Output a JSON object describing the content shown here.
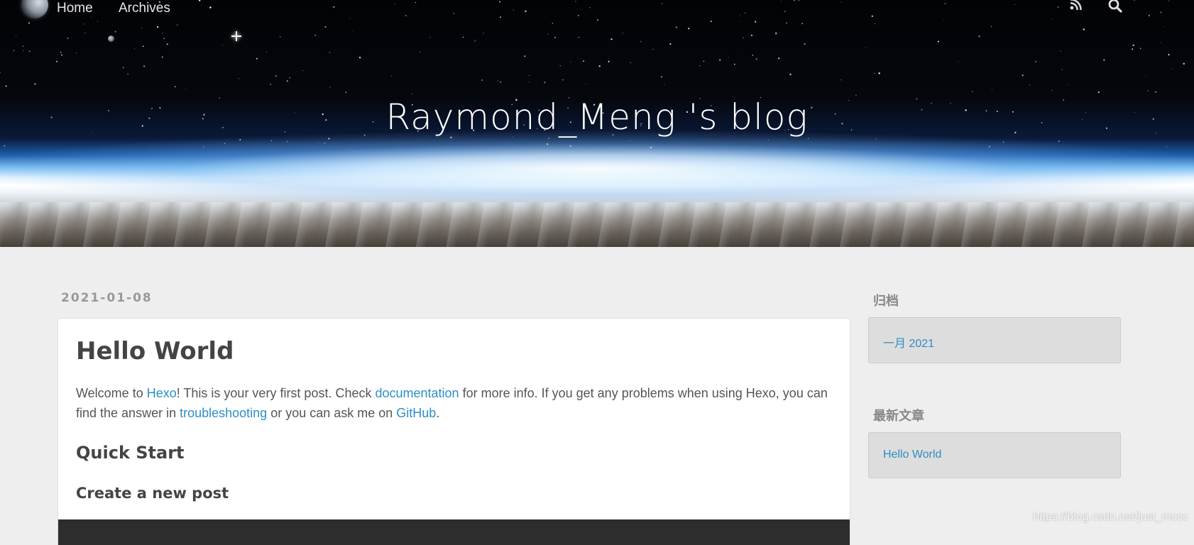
{
  "nav": {
    "items": [
      {
        "label": "Home"
      },
      {
        "label": "Archives"
      }
    ],
    "icons": [
      "rss-icon",
      "search-icon"
    ]
  },
  "site": {
    "title": "Raymond_Meng 's blog"
  },
  "post": {
    "date": "2021-01-08",
    "title": "Hello World",
    "intro": {
      "t1": "Welcome to ",
      "link1": "Hexo",
      "t2": "! This is your very first post. Check ",
      "link2": "documentation",
      "t3": " for more info. If you get any problems when using Hexo, you can find the answer in ",
      "link3": "troubleshooting",
      "t4": " or you can ask me on ",
      "link4": "GitHub",
      "t5": "."
    },
    "h2": "Quick Start",
    "h3": "Create a new post"
  },
  "sidebar": {
    "archive": {
      "title": "归档",
      "items": [
        {
          "label": "一月 2021"
        }
      ]
    },
    "recent": {
      "title": "最新文章",
      "items": [
        {
          "label": "Hello World"
        }
      ]
    }
  },
  "watermark": "https://blog.csdn.net/just_mccc",
  "colors": {
    "link": "#2d8fc3",
    "page_bg": "#eeeeee",
    "widget_bg": "#dddddd",
    "code_bg": "#2d2d2d"
  }
}
